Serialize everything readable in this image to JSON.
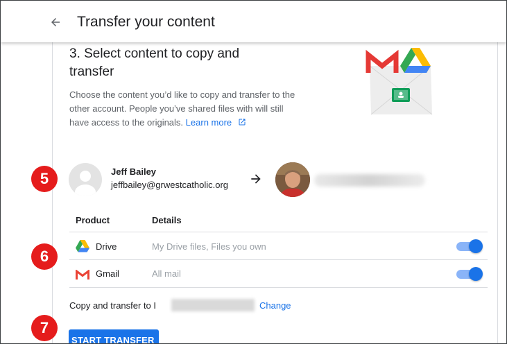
{
  "header": {
    "title": "Transfer your content"
  },
  "step": {
    "title": "3. Select content to copy and transfer",
    "description": "Choose the content you’d like to copy and transfer to the other account. People you’ve shared files with will still have access to the originals.",
    "learn_more": "Learn more"
  },
  "badges": {
    "five": "5",
    "six": "6",
    "seven": "7"
  },
  "source_account": {
    "name": "Jeff Bailey",
    "email": "jeffbailey@grwestcatholic.org"
  },
  "table": {
    "headers": {
      "product": "Product",
      "details": "Details"
    },
    "rows": [
      {
        "product": "Drive",
        "details": "My Drive files, Files you own",
        "icon": "google-drive-icon",
        "enabled": true
      },
      {
        "product": "Gmail",
        "details": "All mail",
        "icon": "gmail-icon",
        "enabled": true
      }
    ]
  },
  "destination": {
    "label": "Copy and transfer to I",
    "change_link": "Change"
  },
  "actions": {
    "start": "START TRANSFER"
  },
  "colors": {
    "accent": "#1a73e8",
    "badge": "#e51c1c",
    "toggle_track": "#8ab4f8"
  }
}
